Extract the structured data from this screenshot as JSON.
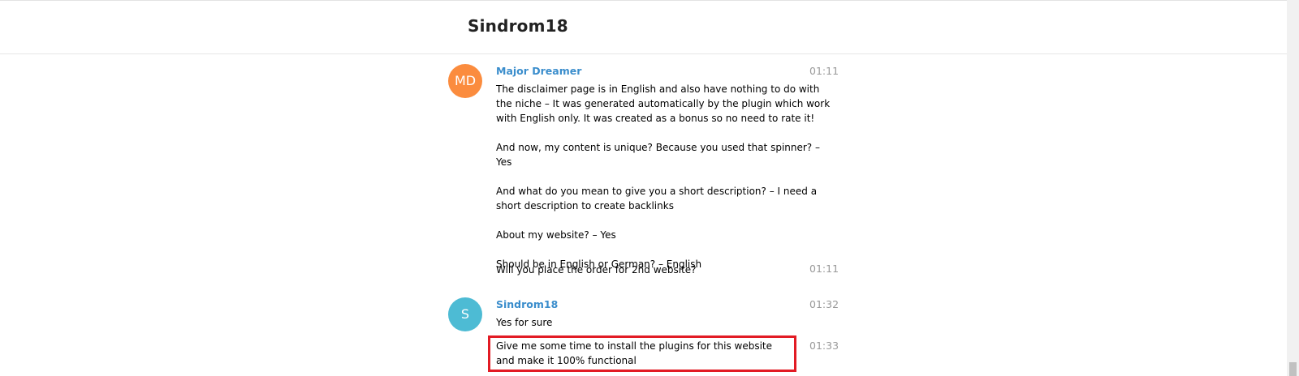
{
  "header": {
    "title": "Sindrom18"
  },
  "messages": [
    {
      "avatar_initials": "MD",
      "sender": "Major Dreamer",
      "time": "01:11",
      "text": "The disclaimer page is in English and also have nothing to do with the niche – It was generated automatically by the plugin which work with English only. It was created as a bonus so no need to rate it!\n\nAnd now, my content is unique? Because you used that spinner? – Yes\n\nAnd what do you mean to give you a short description? – I need a short description to create backlinks\n\nAbout my website? – Yes\n\nShould be in English or German? – English"
    },
    {
      "sender": "",
      "time": "01:11",
      "text": "Will you place the order for 2nd website?"
    },
    {
      "avatar_initials": "S",
      "sender": "Sindrom18",
      "time": "01:32",
      "text": "Yes for sure"
    },
    {
      "sender": "",
      "time": "01:33",
      "text": "Give me some time to install the plugins for this website and make it 100% functional",
      "highlighted": true
    }
  ],
  "colors": {
    "sender_name": "#3a8dcc",
    "avatar_md": "#fb8c3e",
    "avatar_s": "#4dbbd4",
    "highlight": "#e21b24"
  }
}
